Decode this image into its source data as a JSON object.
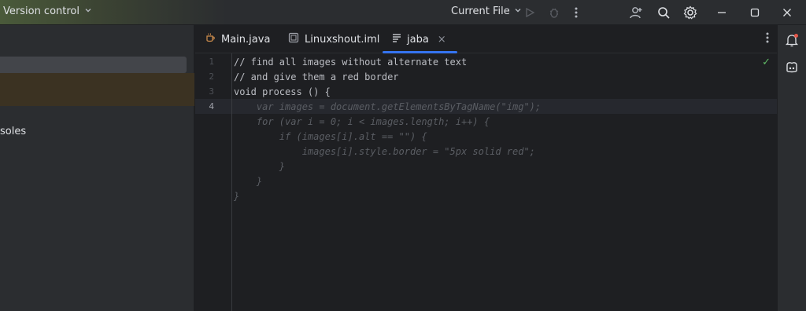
{
  "titlebar": {
    "vcs_label": "Version control",
    "run_config_label": "Current File",
    "icons": [
      "chevron-down-icon",
      "run-icon",
      "debug-icon",
      "more-icon",
      "add-user-icon",
      "search-icon",
      "settings-icon",
      "minimize-icon",
      "maximize-icon",
      "close-icon"
    ]
  },
  "left_panel": {
    "partial_text": "soles"
  },
  "tabs": [
    {
      "label": "Main.java",
      "icon": "java-file-icon"
    },
    {
      "label": "Linuxshout.iml",
      "icon": "module-file-icon"
    },
    {
      "label": "jaba",
      "icon": "text-file-icon",
      "active": true,
      "close_glyph": "×"
    }
  ],
  "editor": {
    "line_numbers": [
      "1",
      "2",
      "3",
      "4"
    ],
    "current_line": "4",
    "lines": [
      "// find all images without alternate text",
      "// and give them a red border",
      "void process () {",
      "    var images = document.getElementsByTagName(\"img\");",
      "    for (var i = 0; i < images.length; i++) {",
      "        if (images[i].alt == \"\") {",
      "            images[i].style.border = \"5px solid red\";",
      "        }",
      "    }",
      "}"
    ],
    "status_glyph": "✓"
  },
  "colors": {
    "accent": "#3574f0",
    "editor_bg": "#1e1f22",
    "panel_bg": "#2b2d30",
    "ok_green": "#5fb865"
  }
}
